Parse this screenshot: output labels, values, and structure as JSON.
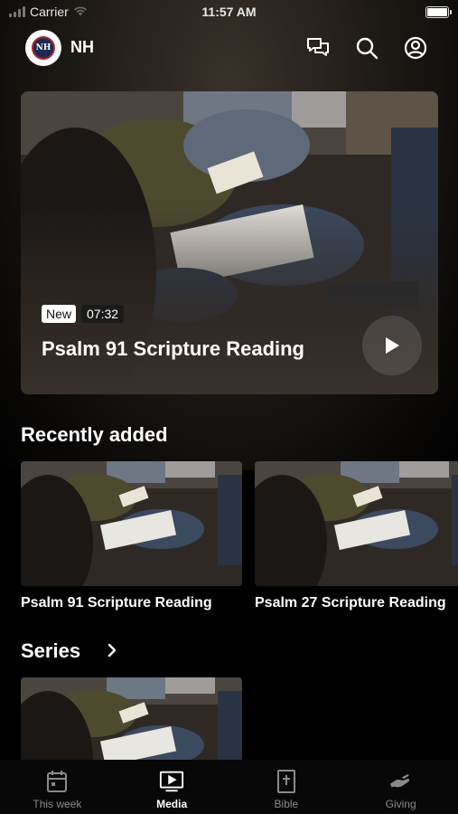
{
  "status_bar": {
    "carrier": "Carrier",
    "time": "11:57 AM"
  },
  "header": {
    "logo_text": "NH",
    "app_name": "NH",
    "icons": [
      "messages-icon",
      "search-icon",
      "account-icon"
    ]
  },
  "hero": {
    "badge_new": "New",
    "duration": "07:32",
    "title": "Psalm 91 Scripture Reading"
  },
  "recently_added": {
    "heading": "Recently added",
    "items": [
      {
        "title": "Psalm 91 Scripture Reading"
      },
      {
        "title": "Psalm 27 Scripture Reading"
      }
    ]
  },
  "series": {
    "heading": "Series"
  },
  "tabs": [
    {
      "label": "This week",
      "icon": "calendar-icon",
      "active": false
    },
    {
      "label": "Media",
      "icon": "video-play-icon",
      "active": true
    },
    {
      "label": "Bible",
      "icon": "bible-icon",
      "active": false
    },
    {
      "label": "Giving",
      "icon": "giving-hand-icon",
      "active": false
    }
  ],
  "colors": {
    "accent": "#ffffff",
    "inactive": "#8a8a8a",
    "background": "#000000"
  }
}
